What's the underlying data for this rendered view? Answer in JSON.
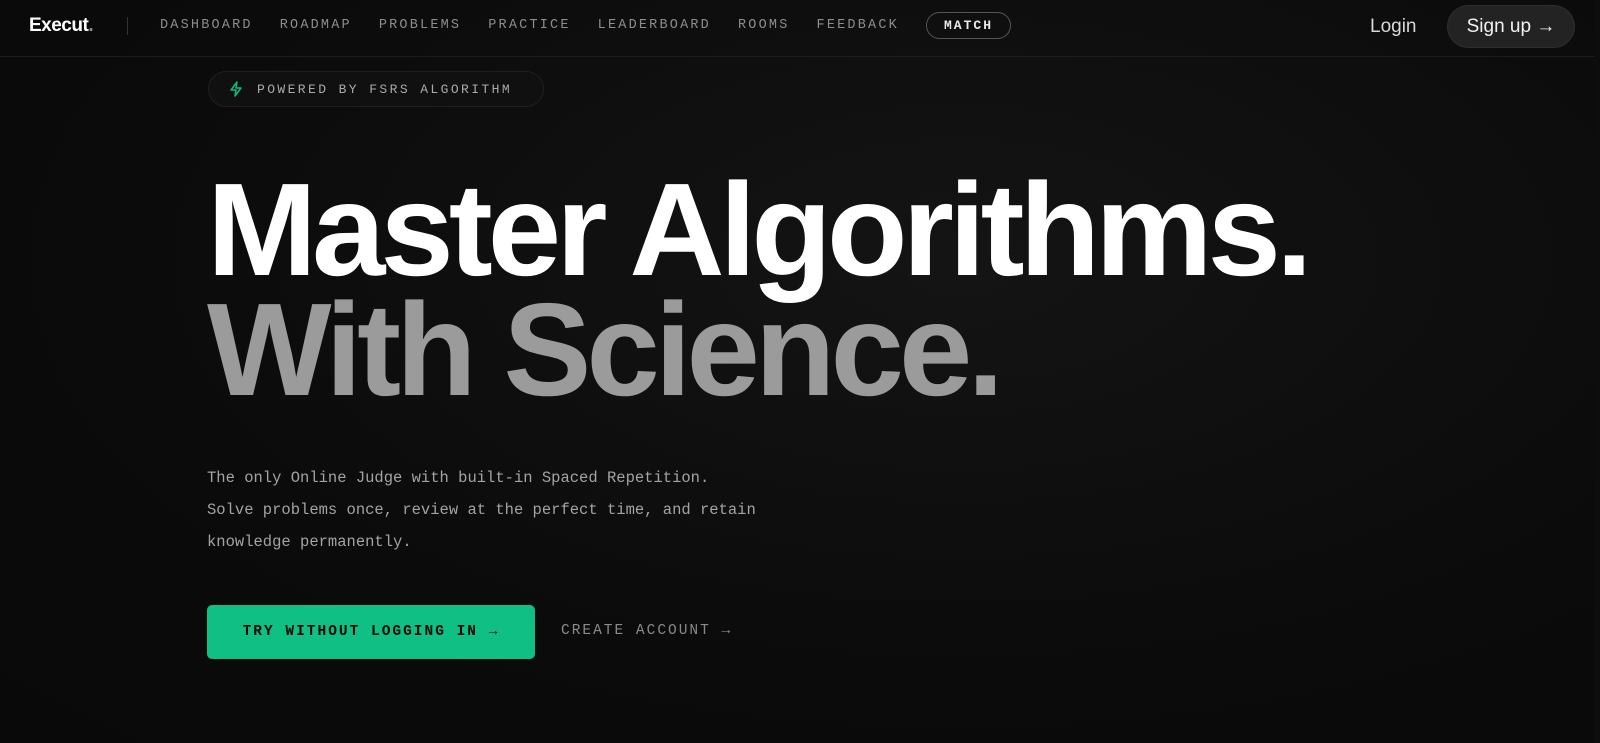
{
  "nav": {
    "logo": "Execut",
    "logo_dot": ".",
    "links": [
      "DASHBOARD",
      "ROADMAP",
      "PROBLEMS",
      "PRACTICE",
      "LEADERBOARD",
      "ROOMS",
      "FEEDBACK"
    ],
    "match": "MATCH",
    "login": "Login",
    "signup": "Sign up →"
  },
  "hero": {
    "badge_icon": "lightning-icon",
    "badge": "POWERED BY FSRS ALGORITHM",
    "headline_line1": "Master Algorithms.",
    "headline_line2": "With Science.",
    "description": [
      "The only Online Judge with built-in Spaced Repetition.",
      "Solve problems once, review at the perfect time, and retain",
      "knowledge permanently."
    ],
    "cta_primary": "TRY WITHOUT LOGGING IN  →",
    "cta_secondary": "CREATE ACCOUNT →"
  },
  "colors": {
    "background": "#0b0b0b",
    "accent": "#0fbf83",
    "headline_muted": "#9b9b9b"
  }
}
